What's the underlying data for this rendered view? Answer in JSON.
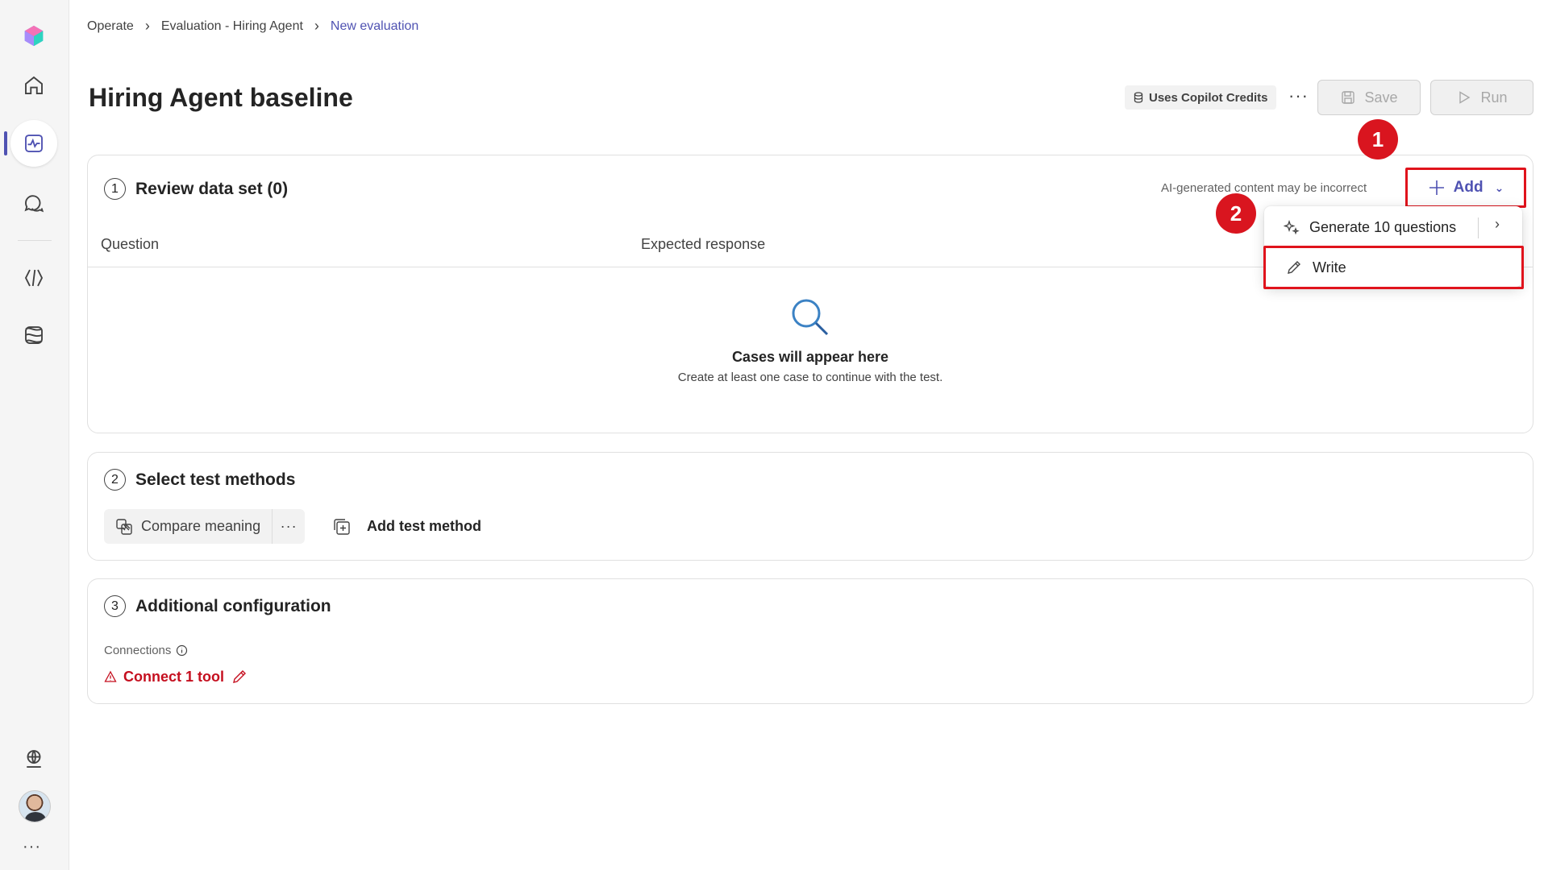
{
  "breadcrumb": {
    "items": [
      "Operate",
      "Evaluation - Hiring Agent"
    ],
    "current": "New evaluation"
  },
  "page": {
    "title": "Hiring Agent baseline"
  },
  "header": {
    "credits_label": "Uses Copilot Credits",
    "more_label": "···",
    "save_label": "Save",
    "run_label": "Run"
  },
  "review": {
    "step": "1",
    "title": "Review data set (0)",
    "ai_note": "AI-generated content may be incorrect",
    "add_label": "Add",
    "columns": [
      "Question",
      "Expected response"
    ],
    "empty_title": "Cases will appear here",
    "empty_subtitle": "Create at least one case to continue with the test."
  },
  "add_menu": {
    "generate_label": "Generate 10 questions",
    "write_label": "Write"
  },
  "methods": {
    "step": "2",
    "title": "Select test methods",
    "chip_label": "Compare meaning",
    "chip_more": "···",
    "add_label": "Add test method"
  },
  "config": {
    "step": "3",
    "title": "Additional configuration",
    "connections_label": "Connections",
    "connect_label": "Connect 1 tool"
  },
  "annotations": {
    "marker_1": "1",
    "marker_2": "2"
  },
  "rail": {
    "more_label": "···"
  },
  "colors": {
    "accent": "#4f52b2",
    "highlight": "#e0131c",
    "warning": "#c50f1f"
  }
}
